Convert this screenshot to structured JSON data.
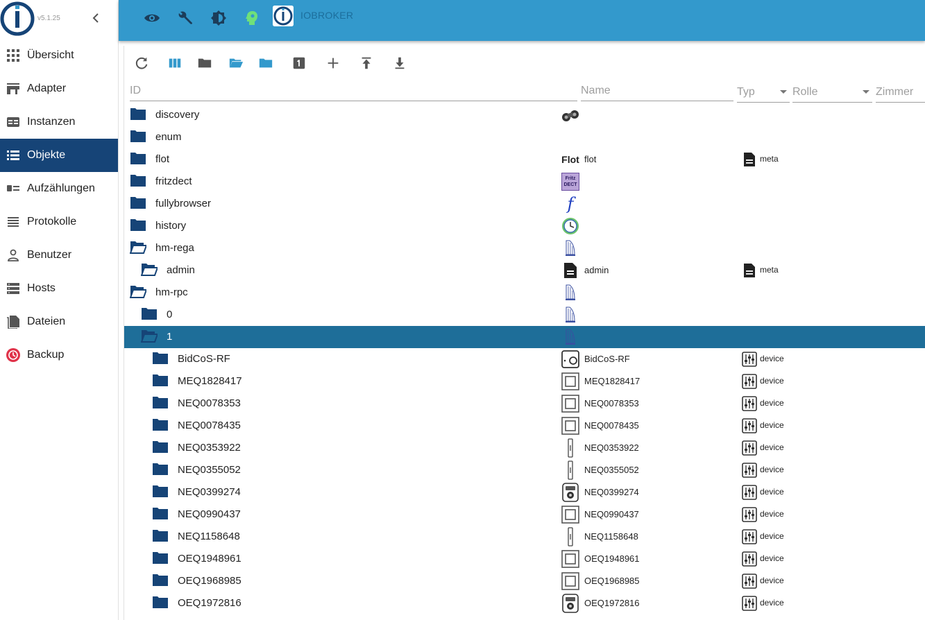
{
  "app": {
    "version": "v5.1.25",
    "brand": "IOBROKER"
  },
  "sidebar": {
    "items": [
      {
        "label": "Übersicht",
        "icon": "grid-icon"
      },
      {
        "label": "Adapter",
        "icon": "store-icon"
      },
      {
        "label": "Instanzen",
        "icon": "instances-icon"
      },
      {
        "label": "Objekte",
        "icon": "list-icon",
        "active": true
      },
      {
        "label": "Aufzählungen",
        "icon": "enum-icon"
      },
      {
        "label": "Protokolle",
        "icon": "log-icon"
      },
      {
        "label": "Benutzer",
        "icon": "user-icon"
      },
      {
        "label": "Hosts",
        "icon": "hosts-icon"
      },
      {
        "label": "Dateien",
        "icon": "files-icon"
      },
      {
        "label": "Backup",
        "icon": "backup-icon"
      }
    ]
  },
  "topbar": {
    "icons": [
      "eye-icon",
      "wrench-icon",
      "theme-icon",
      "expert-mode-icon"
    ]
  },
  "toolbar": {
    "buttons": [
      "refresh-icon",
      "columns-icon",
      "folder-icon",
      "folder-open-icon",
      "folder-blue-icon",
      "one-icon",
      "add-icon",
      "upload-icon",
      "download-icon"
    ]
  },
  "columns": {
    "id": "ID",
    "name": "Name",
    "type": "Typ",
    "role": "Rolle",
    "room": "Zimmer"
  },
  "colors": {
    "topbar": "#3399cc",
    "sidebar_active": "#164477",
    "selected_row": "#1e6e99",
    "folder": "#164477"
  },
  "rows": [
    {
      "id": "discovery",
      "level": 0,
      "open": false,
      "icon": "binoculars-icon",
      "name": "",
      "type": ""
    },
    {
      "id": "enum",
      "level": 0,
      "open": false,
      "icon": "",
      "name": "",
      "type": ""
    },
    {
      "id": "flot",
      "level": 0,
      "open": false,
      "icon": "flot-logo",
      "iconText": "Flot",
      "name": "flot",
      "type": "meta"
    },
    {
      "id": "fritzdect",
      "level": 0,
      "open": false,
      "icon": "fritz-dect-icon",
      "iconText": "Fritz DECT",
      "name": "",
      "type": ""
    },
    {
      "id": "fullybrowser",
      "level": 0,
      "open": false,
      "icon": "fully-f-icon",
      "iconText": "f",
      "name": "",
      "type": ""
    },
    {
      "id": "history",
      "level": 0,
      "open": false,
      "icon": "clock-icon",
      "name": "",
      "type": ""
    },
    {
      "id": "hm-rega",
      "level": 0,
      "open": true,
      "icon": "homematic-icon",
      "name": "",
      "type": ""
    },
    {
      "id": "admin",
      "level": 1,
      "open": true,
      "icon": "document-icon",
      "name": "admin",
      "type": "meta"
    },
    {
      "id": "hm-rpc",
      "level": 0,
      "open": true,
      "icon": "homematic-icon",
      "name": "",
      "type": ""
    },
    {
      "id": "0",
      "level": 1,
      "open": false,
      "icon": "homematic-icon",
      "name": "",
      "type": ""
    },
    {
      "id": "1",
      "level": 1,
      "open": true,
      "icon": "homematic-icon",
      "name": "",
      "type": "",
      "selected": true
    },
    {
      "id": "BidCoS-RF",
      "level": 2,
      "open": false,
      "icon": "ccu-device-icon",
      "name": "BidCoS-RF",
      "type": "device"
    },
    {
      "id": "MEQ1828417",
      "level": 2,
      "open": false,
      "icon": "switch-device-icon",
      "name": "MEQ1828417",
      "type": "device"
    },
    {
      "id": "NEQ0078353",
      "level": 2,
      "open": false,
      "icon": "switch-device-icon",
      "name": "NEQ0078353",
      "type": "device"
    },
    {
      "id": "NEQ0078435",
      "level": 2,
      "open": false,
      "icon": "switch-device-icon",
      "name": "NEQ0078435",
      "type": "device"
    },
    {
      "id": "NEQ0353922",
      "level": 2,
      "open": false,
      "icon": "window-contact-icon",
      "name": "NEQ0353922",
      "type": "device"
    },
    {
      "id": "NEQ0355052",
      "level": 2,
      "open": false,
      "icon": "window-contact-icon",
      "name": "NEQ0355052",
      "type": "device"
    },
    {
      "id": "NEQ0399274",
      "level": 2,
      "open": false,
      "icon": "thermostat-icon",
      "name": "NEQ0399274",
      "type": "device"
    },
    {
      "id": "NEQ0990437",
      "level": 2,
      "open": false,
      "icon": "switch-device-icon",
      "name": "NEQ0990437",
      "type": "device"
    },
    {
      "id": "NEQ1158648",
      "level": 2,
      "open": false,
      "icon": "window-contact-icon",
      "name": "NEQ1158648",
      "type": "device"
    },
    {
      "id": "OEQ1948961",
      "level": 2,
      "open": false,
      "icon": "switch-device-icon",
      "name": "OEQ1948961",
      "type": "device"
    },
    {
      "id": "OEQ1968985",
      "level": 2,
      "open": false,
      "icon": "switch-device-icon",
      "name": "OEQ1968985",
      "type": "device"
    },
    {
      "id": "OEQ1972816",
      "level": 2,
      "open": false,
      "icon": "thermostat-icon",
      "name": "OEQ1972816",
      "type": "device"
    }
  ]
}
